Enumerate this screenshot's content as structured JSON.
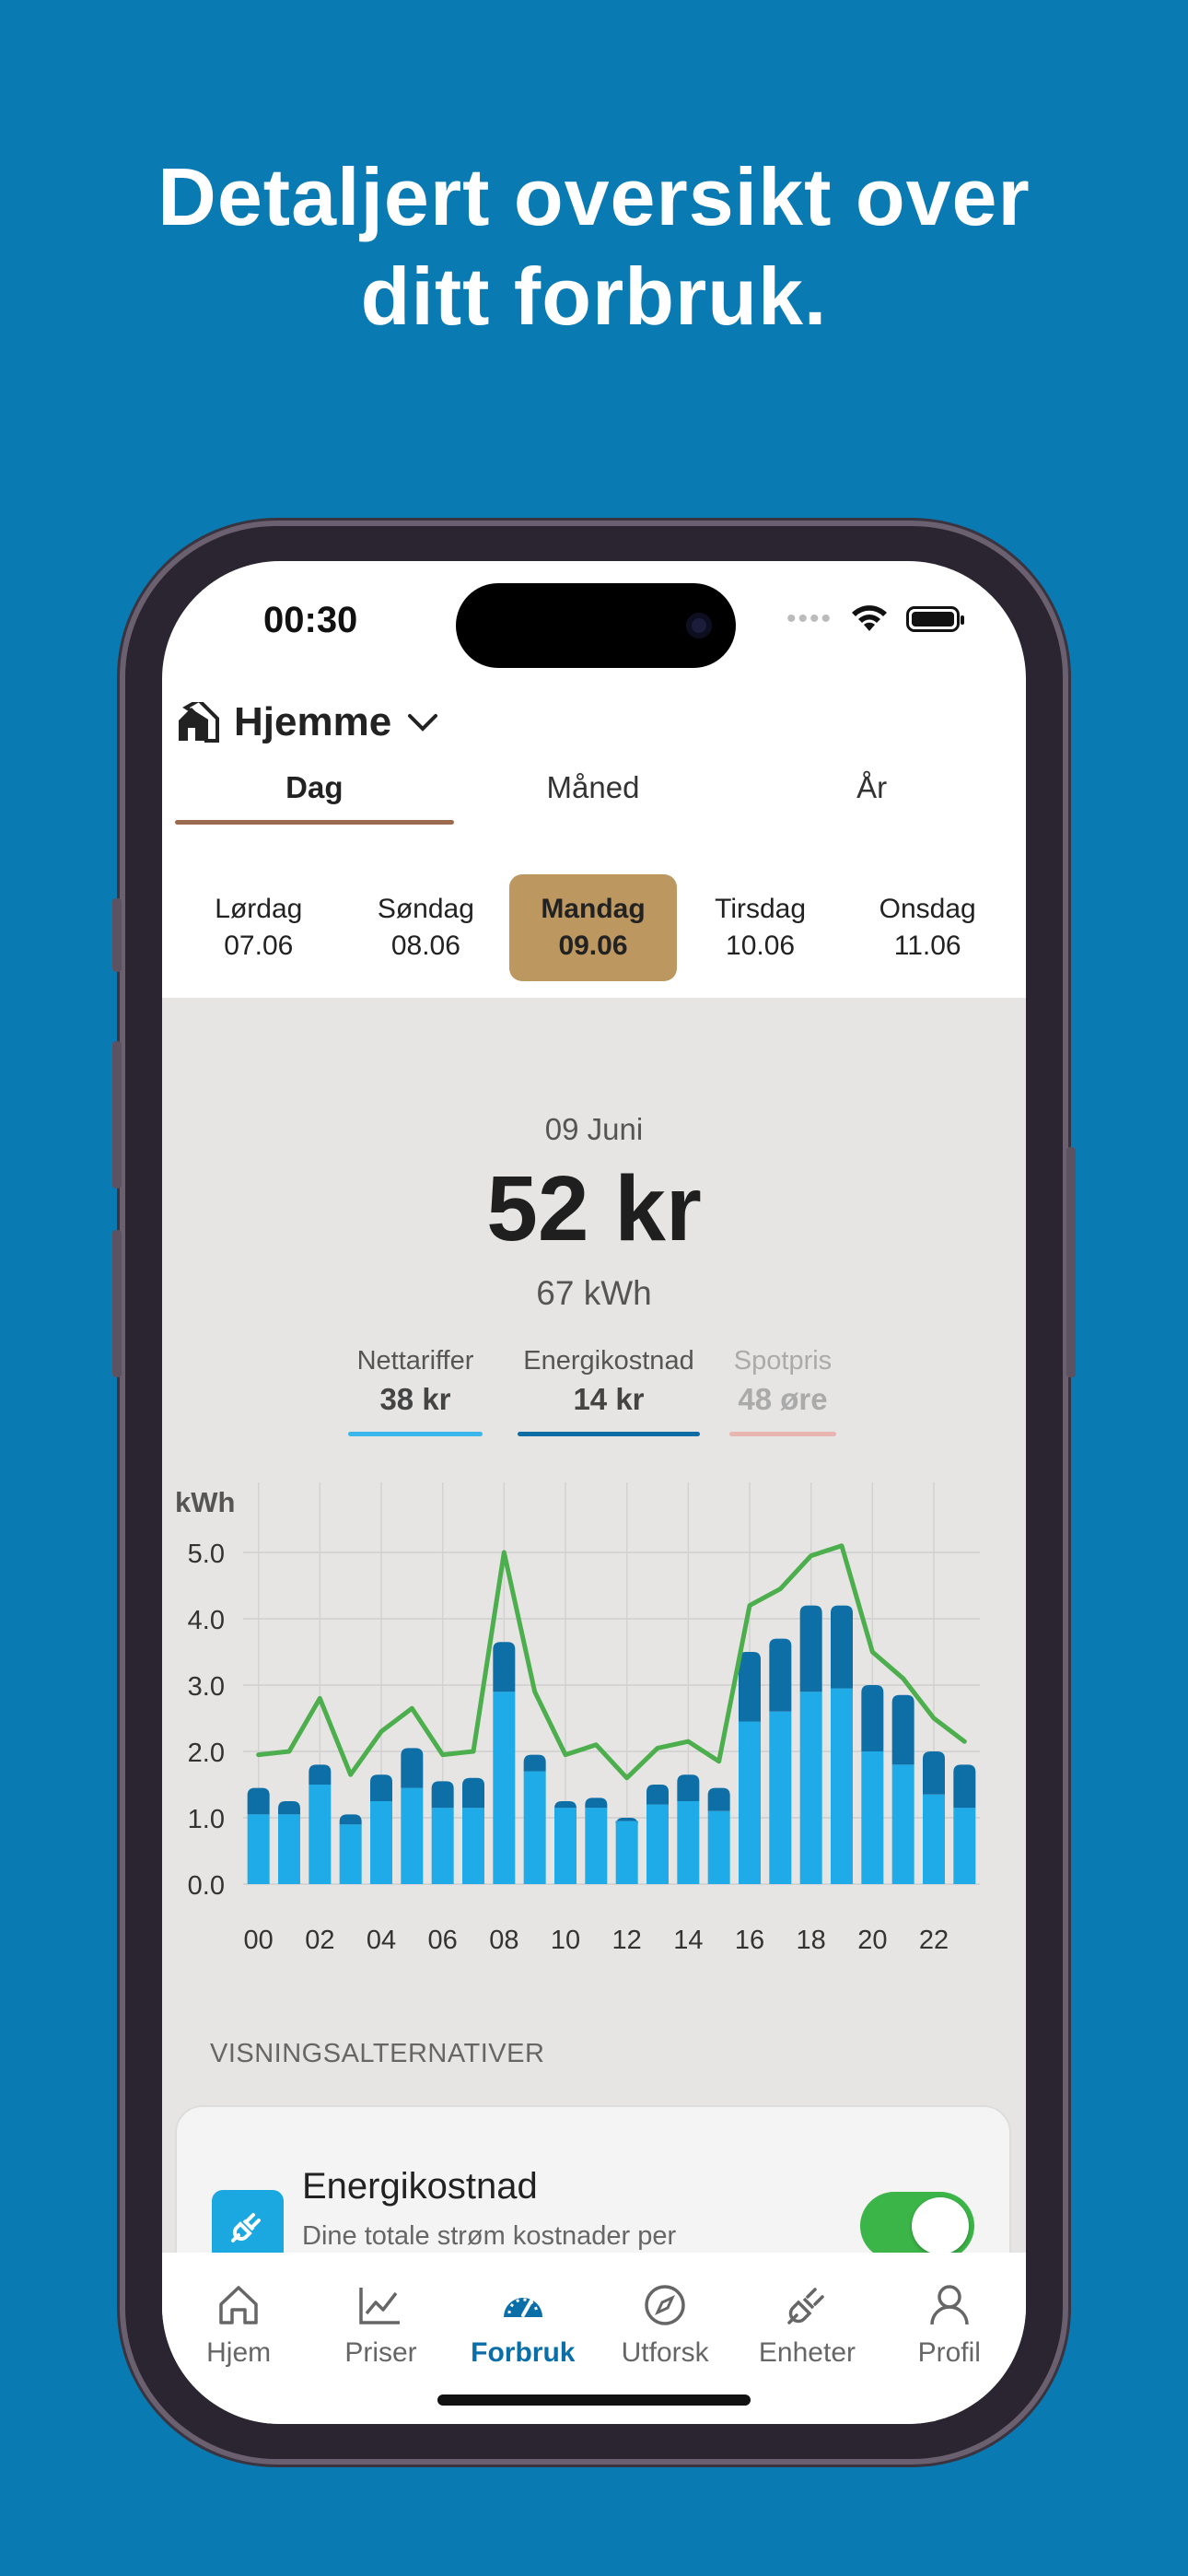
{
  "headline": {
    "line1": "Detaljert oversikt over",
    "line2": "ditt forbruk."
  },
  "status_bar": {
    "time": "00:30",
    "signal_dots": "••••"
  },
  "header": {
    "home_name": "Hjemme"
  },
  "tabs": [
    {
      "label": "Dag",
      "active": true
    },
    {
      "label": "Måned",
      "active": false
    },
    {
      "label": "År",
      "active": false
    }
  ],
  "days": [
    {
      "name": "Lørdag",
      "date": "07.06",
      "active": false
    },
    {
      "name": "Søndag",
      "date": "08.06",
      "active": false
    },
    {
      "name": "Mandag",
      "date": "09.06",
      "active": true
    },
    {
      "name": "Tirsdag",
      "date": "10.06",
      "active": false
    },
    {
      "name": "Onsdag",
      "date": "11.06",
      "active": false
    }
  ],
  "summary": {
    "date": "09 Juni",
    "amount": "52 kr",
    "kwh": "67 kWh"
  },
  "breakdown": [
    {
      "label": "Nettariffer",
      "value": "38 kr",
      "color": "#3BB7EC"
    },
    {
      "label": "Energikostnad",
      "value": "14 kr",
      "color": "#0E6CA4"
    },
    {
      "label": "Spotpris",
      "value": "48 øre",
      "color": "#E8B5B0"
    }
  ],
  "chart_data": {
    "type": "bar",
    "ylabel": "kWh",
    "ylim": [
      0,
      5.5
    ],
    "yticks": [
      "0.0",
      "1.0",
      "2.0",
      "3.0",
      "4.0",
      "5.0"
    ],
    "xtick_labels": [
      "00",
      "02",
      "04",
      "06",
      "08",
      "10",
      "12",
      "14",
      "16",
      "18",
      "20",
      "22"
    ],
    "categories": [
      "00",
      "01",
      "02",
      "03",
      "04",
      "05",
      "06",
      "07",
      "08",
      "09",
      "10",
      "11",
      "12",
      "13",
      "14",
      "15",
      "16",
      "17",
      "18",
      "19",
      "20",
      "21",
      "22",
      "23"
    ],
    "series": [
      {
        "kind": "bar",
        "color": "#1FAAE8",
        "values": [
          1.05,
          1.05,
          1.5,
          0.9,
          1.25,
          1.45,
          1.15,
          1.15,
          2.9,
          1.7,
          1.15,
          1.15,
          0.95,
          1.2,
          1.25,
          1.1,
          2.45,
          2.6,
          2.9,
          2.95,
          2.0,
          1.8,
          1.35,
          1.15
        ]
      },
      {
        "kind": "bar",
        "color": "#0E6FA7",
        "values": [
          0.4,
          0.2,
          0.3,
          0.15,
          0.4,
          0.6,
          0.4,
          0.45,
          0.75,
          0.25,
          0.1,
          0.15,
          0.05,
          0.3,
          0.4,
          0.35,
          1.05,
          1.1,
          1.3,
          1.25,
          1.0,
          1.05,
          0.65,
          0.65
        ]
      },
      {
        "kind": "line",
        "color": "#4CAE4C",
        "values": [
          1.95,
          2.0,
          2.8,
          1.65,
          2.3,
          2.65,
          1.95,
          2.0,
          5.0,
          2.9,
          1.95,
          2.1,
          1.6,
          2.05,
          2.15,
          1.85,
          4.2,
          4.45,
          4.95,
          5.1,
          3.5,
          3.1,
          2.5,
          2.15
        ]
      }
    ],
    "grid": true
  },
  "options": {
    "section_title": "VISNINGSALTERNATIVER",
    "card_title": "Energikostnad",
    "card_subtitle": "Dine totale strøm kostnader per",
    "toggle_on": true
  },
  "tabbar": [
    {
      "label": "Hjem",
      "icon": "house-icon",
      "active": false
    },
    {
      "label": "Priser",
      "icon": "line-chart-icon",
      "active": false
    },
    {
      "label": "Forbruk",
      "icon": "gauge-icon",
      "active": true
    },
    {
      "label": "Utforsk",
      "icon": "compass-icon",
      "active": false
    },
    {
      "label": "Enheter",
      "icon": "plug-icon",
      "active": false
    },
    {
      "label": "Profil",
      "icon": "person-icon",
      "active": false
    }
  ],
  "colors": {
    "background": "#0A7AB3",
    "accent_tab": "#9B6B4F",
    "selected_day": "#BD9760",
    "active_nav": "#0A6FA8"
  }
}
